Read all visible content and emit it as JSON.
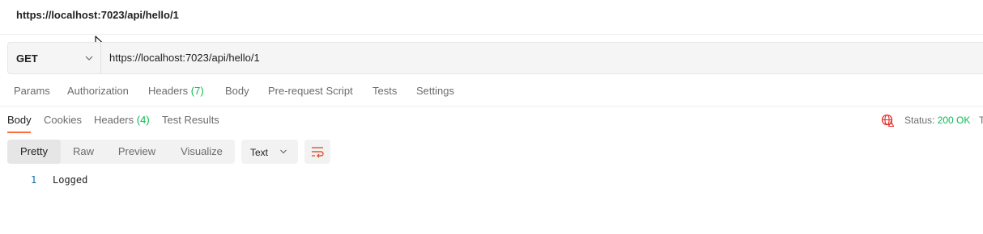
{
  "title": "https://localhost:7023/api/hello/1",
  "request": {
    "method": "GET",
    "url": "https://localhost:7023/api/hello/1"
  },
  "request_tabs": [
    {
      "label": "Params"
    },
    {
      "label": "Authorization"
    },
    {
      "label": "Headers",
      "count": "(7)"
    },
    {
      "label": "Body"
    },
    {
      "label": "Pre-request Script"
    },
    {
      "label": "Tests"
    },
    {
      "label": "Settings"
    }
  ],
  "response_tabs": [
    {
      "label": "Body"
    },
    {
      "label": "Cookies"
    },
    {
      "label": "Headers",
      "count": "(4)"
    },
    {
      "label": "Test Results"
    }
  ],
  "response_status": {
    "label": "Status:",
    "value": "200 OK",
    "truncated": "T"
  },
  "view_modes": [
    "Pretty",
    "Raw",
    "Preview",
    "Visualize"
  ],
  "format": "Text",
  "body_lines": [
    {
      "number": "1",
      "text": "Logged"
    }
  ],
  "icons": {
    "method_chevron": "chevron-down-icon",
    "format_chevron": "chevron-down-icon",
    "wrap": "wrap-lines-icon",
    "network": "globe-icon",
    "cursor": "mouse-cursor-icon"
  },
  "colors": {
    "accent": "#ff6c37",
    "count": "#0cbb52",
    "status_ok": "#0cbb52",
    "line_number": "#0b6bb3"
  }
}
